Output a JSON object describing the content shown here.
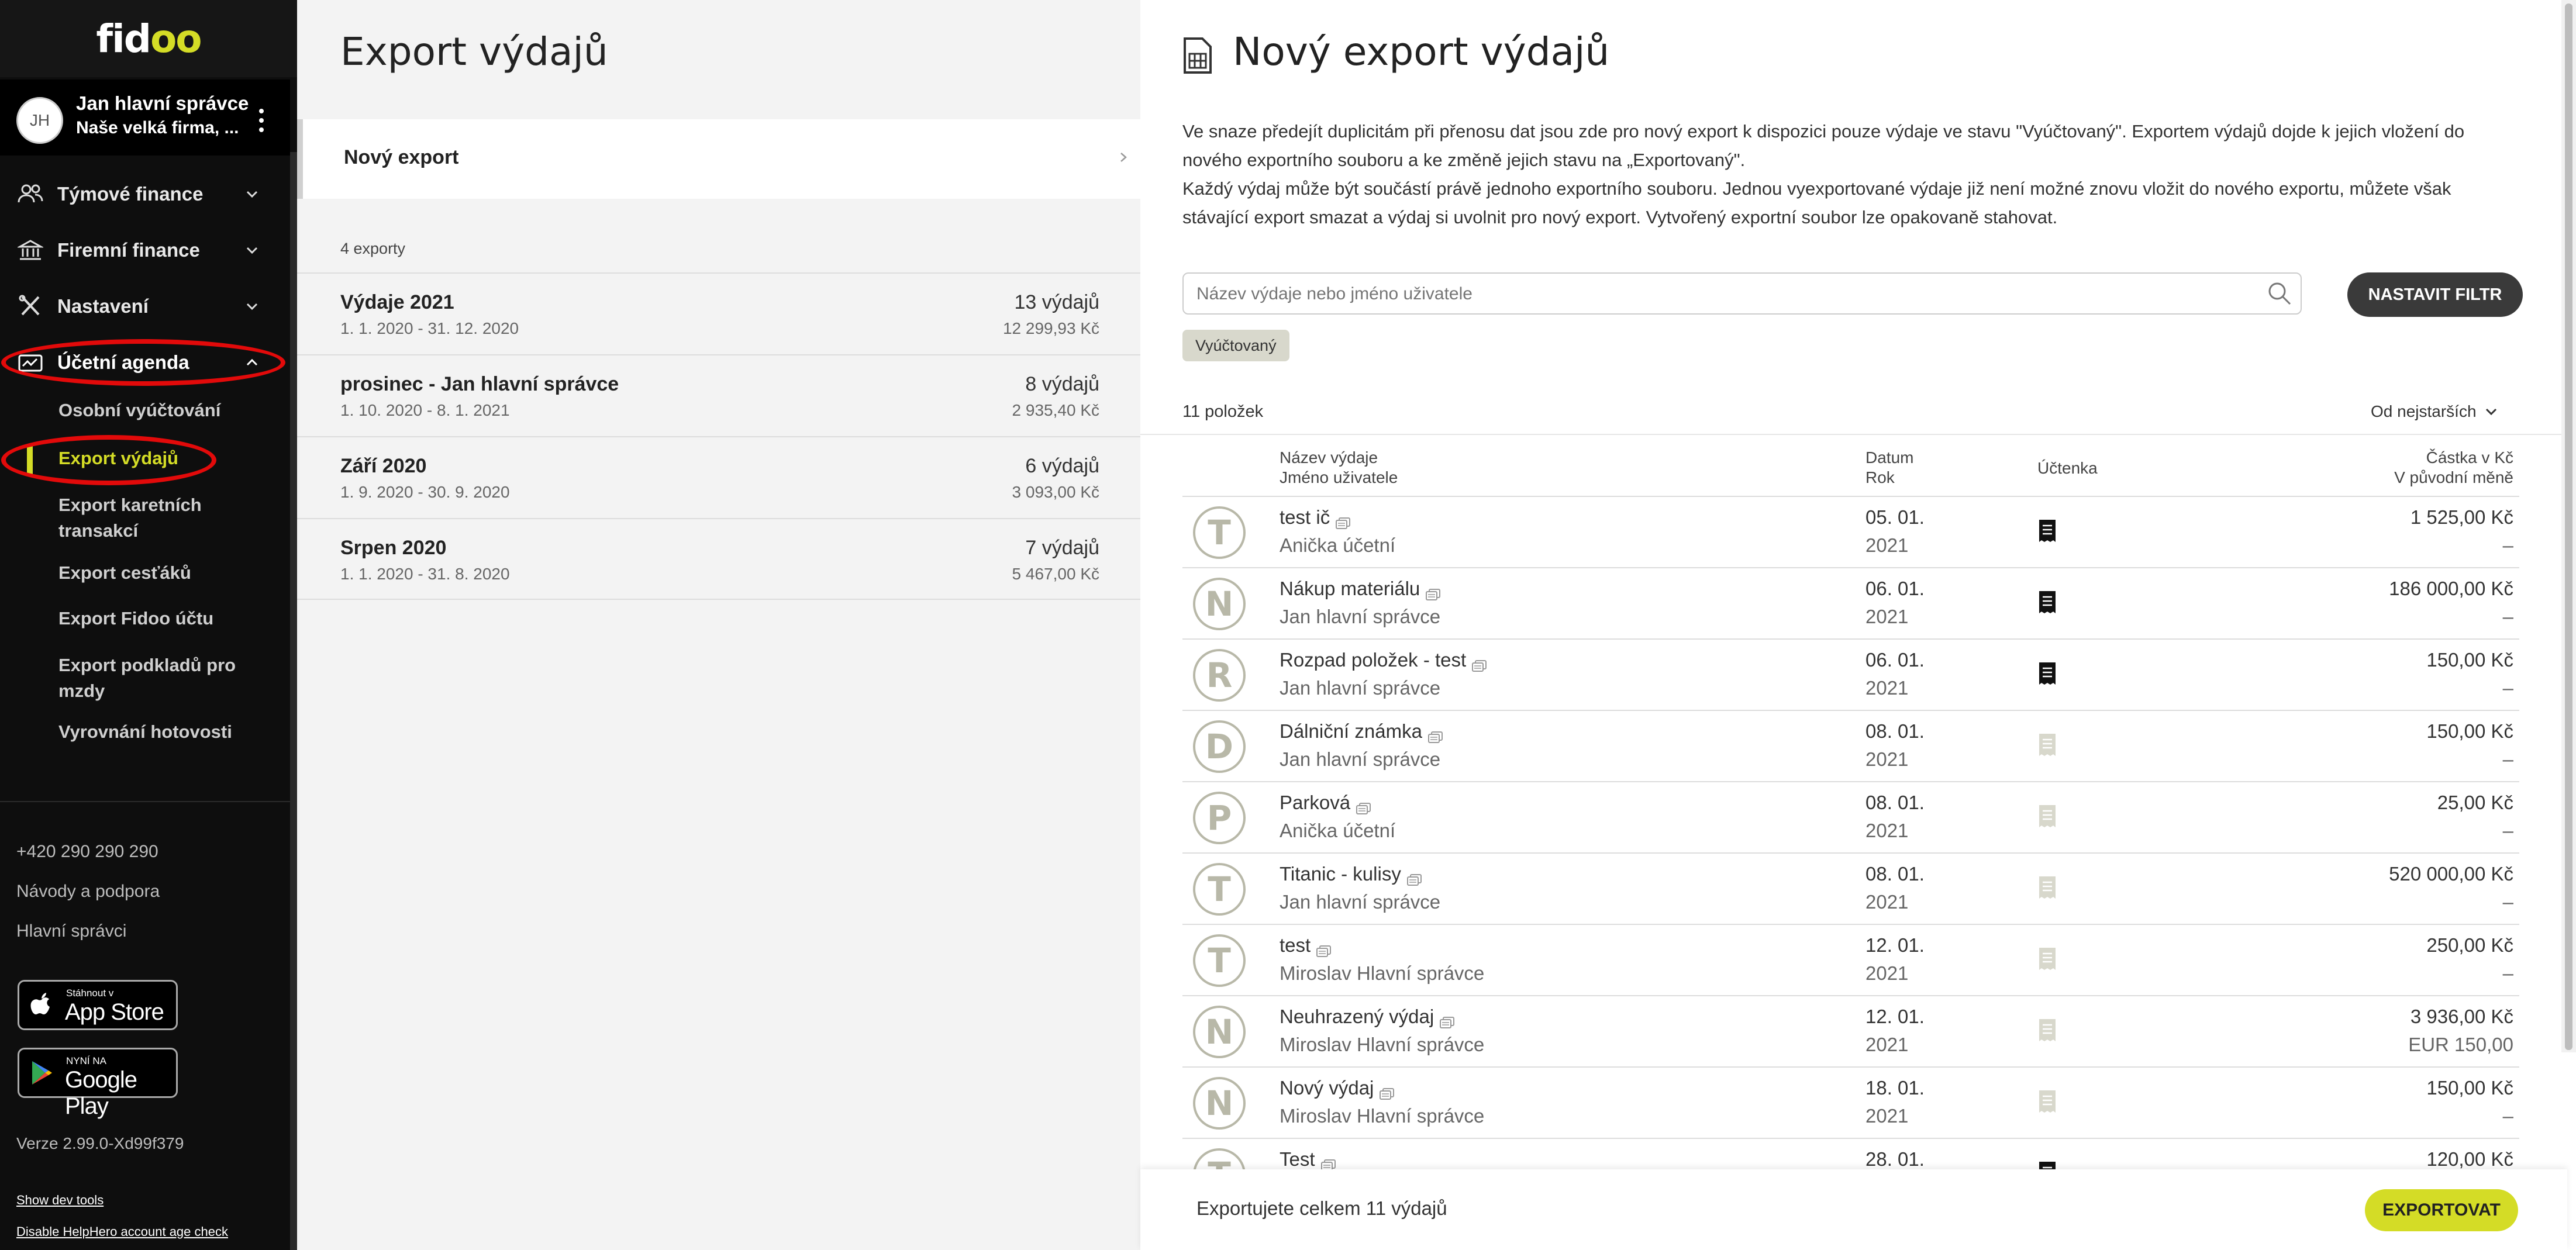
{
  "app": {
    "logo": "fidoo",
    "logo_a": "fid",
    "logo_b": "oo"
  },
  "user": {
    "initials": "JH",
    "name": "Jan hlavní správce",
    "company": "Naše velká firma, ..."
  },
  "nav": {
    "groups": [
      {
        "label": "Týmové finance",
        "icon": "team-icon",
        "expanded": false
      },
      {
        "label": "Firemní finance",
        "icon": "bank-icon",
        "expanded": false
      },
      {
        "label": "Nastavení",
        "icon": "tools-icon",
        "expanded": false
      },
      {
        "label": "Účetní agenda",
        "icon": "accounting-icon",
        "expanded": true
      }
    ],
    "sub_items": [
      "Osobní vyúčtování",
      "Export výdajů",
      "Export karetních transakcí",
      "Export cesťáků",
      "Export Fidoo účtu",
      "Export podkladů pro mzdy",
      "Vyrovnání hotovosti"
    ],
    "active_sub": "Export výdajů",
    "phone": "+420 290 290 290",
    "help": "Návody a podpora",
    "admins": "Hlavní správci",
    "appstore_small": "Stáhnout v",
    "appstore_big": "App Store",
    "gplay_small": "NYNÍ NA",
    "gplay_big": "Google Play",
    "version": "Verze 2.99.0-Xd99f379",
    "dev_tools": "Show dev tools",
    "helphero": "Disable HelpHero account age check"
  },
  "exports": {
    "title": "Export výdajů",
    "new_export": "Nový export",
    "count": "4 exporty",
    "items": [
      {
        "name": "Výdaje 2021",
        "dates": "1. 1. 2020 - 31. 12. 2020",
        "count": "13 výdajů",
        "amount": "12 299,93 Kč"
      },
      {
        "name": "prosinec - Jan hlavní správce",
        "dates": "1. 10. 2020 - 8. 1. 2021",
        "count": "8 výdajů",
        "amount": "2 935,40 Kč"
      },
      {
        "name": "Září 2020",
        "dates": "1. 9. 2020 - 30. 9. 2020",
        "count": "6 výdajů",
        "amount": "3 093,00 Kč"
      },
      {
        "name": "Srpen 2020",
        "dates": "1. 1. 2020 - 31. 8. 2020",
        "count": "7 výdajů",
        "amount": "5 467,00 Kč"
      }
    ]
  },
  "detail": {
    "title": "Nový export výdajů",
    "paragraph1": "Ve snaze předejít duplicitám při přenosu dat jsou zde pro nový export k dispozici pouze výdaje ve stavu \"Vyúčtovaný\". Exportem výdajů dojde k jejich vložení do nového exportního souboru a ke změně jejich stavu na „Exportovaný\".",
    "paragraph2": "Každý výdaj může být součástí právě jednoho exportního souboru. Jednou vyexportované výdaje již není možné znovu vložit do nového exportu, můžete však stávající export smazat a výdaj si uvolnit pro nový export. Vytvořený exportní soubor lze opakovaně stahovat.",
    "search_placeholder": "Název výdaje nebo jméno uživatele",
    "filter_button": "NASTAVIT FILTR",
    "chip": "Vyúčtovaný",
    "item_count": "11 položek",
    "sort": "Od nejstarších",
    "columns": {
      "name": "Název výdaje",
      "user": "Jméno uživatele",
      "date": "Datum",
      "year": "Rok",
      "receipt": "Účtenka",
      "amount": "Částka v Kč",
      "original": "V původní měně"
    },
    "rows": [
      {
        "letter": "T",
        "name": "test ič",
        "user": "Anička účetní",
        "date": "05. 01.",
        "year": "2021",
        "receipt": true,
        "amount": "1 525,00 Kč",
        "original": "–"
      },
      {
        "letter": "N",
        "name": "Nákup materiálu",
        "user": "Jan hlavní správce",
        "date": "06. 01.",
        "year": "2021",
        "receipt": true,
        "amount": "186 000,00 Kč",
        "original": "–"
      },
      {
        "letter": "R",
        "name": "Rozpad položek - test",
        "user": "Jan hlavní správce",
        "date": "06. 01.",
        "year": "2021",
        "receipt": true,
        "amount": "150,00 Kč",
        "original": "–"
      },
      {
        "letter": "D",
        "name": "Dálniční známka",
        "user": "Jan hlavní správce",
        "date": "08. 01.",
        "year": "2021",
        "receipt": false,
        "amount": "150,00 Kč",
        "original": "–"
      },
      {
        "letter": "P",
        "name": "Parková",
        "user": "Anička účetní",
        "date": "08. 01.",
        "year": "2021",
        "receipt": false,
        "amount": "25,00 Kč",
        "original": "–"
      },
      {
        "letter": "T",
        "name": "Titanic - kulisy",
        "user": "Jan hlavní správce",
        "date": "08. 01.",
        "year": "2021",
        "receipt": false,
        "amount": "520 000,00 Kč",
        "original": "–"
      },
      {
        "letter": "T",
        "name": "test",
        "user": "Miroslav Hlavní správce",
        "date": "12. 01.",
        "year": "2021",
        "receipt": false,
        "amount": "250,00 Kč",
        "original": "–"
      },
      {
        "letter": "N",
        "name": "Neuhrazený výdaj",
        "user": "Miroslav Hlavní správce",
        "date": "12. 01.",
        "year": "2021",
        "receipt": false,
        "amount": "3 936,00 Kč",
        "original": "EUR 150,00"
      },
      {
        "letter": "N",
        "name": "Nový výdaj",
        "user": "Miroslav Hlavní správce",
        "date": "18. 01.",
        "year": "2021",
        "receipt": false,
        "amount": "150,00 Kč",
        "original": "–"
      },
      {
        "letter": "T",
        "name": "Test",
        "user": "",
        "date": "28. 01.",
        "year": "",
        "receipt": true,
        "amount": "120,00 Kč",
        "original": ""
      }
    ],
    "footer_text": "Exportujete celkem 11 výdajů",
    "export_button": "EXPORTOVAT"
  },
  "colors": {
    "accent": "#d4dc26",
    "sidebar": "#0e0e0e",
    "highlight": "#e20a0a",
    "avatar": "#b8b8a8"
  }
}
